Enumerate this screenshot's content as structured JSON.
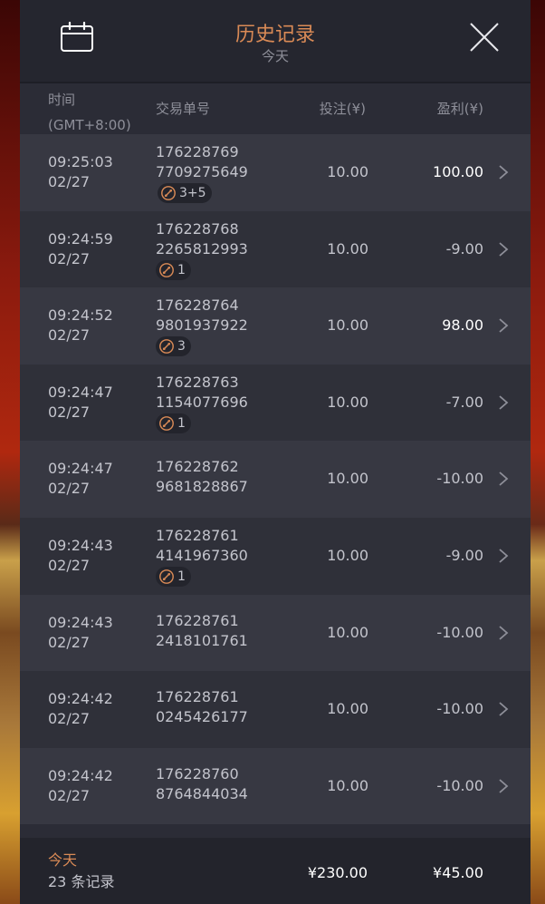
{
  "header": {
    "title": "历史记录",
    "subtitle": "今天"
  },
  "columns": {
    "time_label": "时间",
    "time_tz": "(GMT+8:00)",
    "id_label": "交易单号",
    "bet_label": "投注(¥)",
    "profit_label": "盈利(¥)"
  },
  "rows": [
    {
      "time": "09:25:03",
      "date": "02/27",
      "id_line1": "176228769",
      "id_line2": "7709275649",
      "bet": "10.00",
      "profit": "100.00",
      "win": true,
      "respin": true,
      "badge": "3+5"
    },
    {
      "time": "09:24:59",
      "date": "02/27",
      "id_line1": "176228768",
      "id_line2": "2265812993",
      "bet": "10.00",
      "profit": "-9.00",
      "win": false,
      "respin": false,
      "badge": "1"
    },
    {
      "time": "09:24:52",
      "date": "02/27",
      "id_line1": "176228764",
      "id_line2": "9801937922",
      "bet": "10.00",
      "profit": "98.00",
      "win": true,
      "respin": false,
      "badge": "3"
    },
    {
      "time": "09:24:47",
      "date": "02/27",
      "id_line1": "176228763",
      "id_line2": "1154077696",
      "bet": "10.00",
      "profit": "-7.00",
      "win": false,
      "respin": false,
      "badge": "1"
    },
    {
      "time": "09:24:47",
      "date": "02/27",
      "id_line1": "176228762",
      "id_line2": "9681828867",
      "bet": "10.00",
      "profit": "-10.00",
      "win": false,
      "respin": false,
      "badge": ""
    },
    {
      "time": "09:24:43",
      "date": "02/27",
      "id_line1": "176228761",
      "id_line2": "4141967360",
      "bet": "10.00",
      "profit": "-9.00",
      "win": false,
      "respin": false,
      "badge": "1"
    },
    {
      "time": "09:24:43",
      "date": "02/27",
      "id_line1": "176228761",
      "id_line2": "2418101761",
      "bet": "10.00",
      "profit": "-10.00",
      "win": false,
      "respin": false,
      "badge": ""
    },
    {
      "time": "09:24:42",
      "date": "02/27",
      "id_line1": "176228761",
      "id_line2": "0245426177",
      "bet": "10.00",
      "profit": "-10.00",
      "win": false,
      "respin": false,
      "badge": ""
    },
    {
      "time": "09:24:42",
      "date": "02/27",
      "id_line1": "176228760",
      "id_line2": "8764844034",
      "bet": "10.00",
      "profit": "-10.00",
      "win": false,
      "respin": false,
      "badge": ""
    }
  ],
  "footer": {
    "day_label": "今天",
    "count_label": "23 条记录",
    "total_bet": "¥230.00",
    "total_profit": "¥45.00"
  },
  "colors": {
    "accent": "#d98a56",
    "panel_bg": "#2b2c36",
    "row_odd": "#373842",
    "row_even": "#2f3039",
    "text": "#c3c4cc",
    "muted": "#8e8f99"
  },
  "icons": {
    "calendar": "calendar-icon",
    "close": "close-icon",
    "chevron": "chevron-right-icon",
    "respin": "respin-icon",
    "free_spin": "free-spin-icon"
  }
}
